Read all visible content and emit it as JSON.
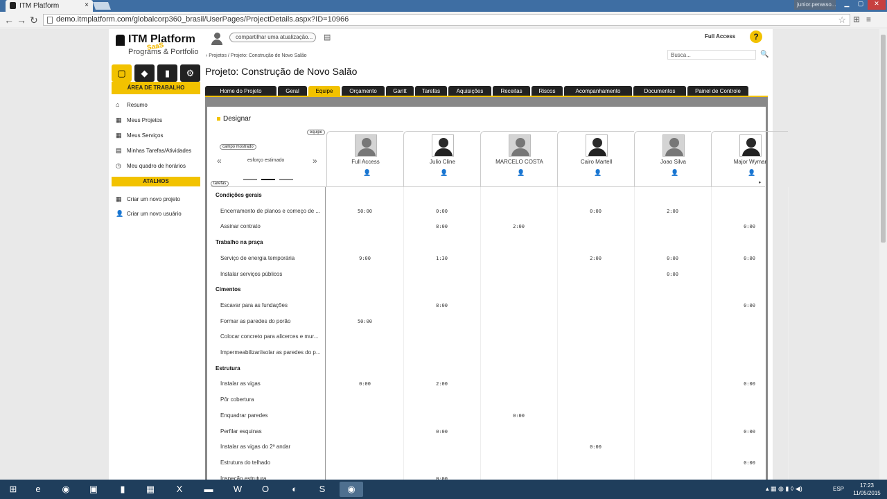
{
  "browser": {
    "tab_title": "ITM Platform",
    "tab_close": "×",
    "user": "junior.perasso...",
    "url": "demo.itmplatform.com/globalcorp360_brasil/UserPages/ProjectDetails.aspx?ID=10966"
  },
  "app": {
    "logo_title": "ITM Platform",
    "logo_subtitle": "Programs & Portfolio",
    "logo_badge": "SaaS",
    "share_placeholder": "compartilhar uma atualização...",
    "full_access": "Full Access",
    "help": "?",
    "breadcrumb": "› Projetos / Projeto: Construção de Novo Salão",
    "search_placeholder": "Busca...",
    "project_title": "Projeto: Construção de Novo Salão"
  },
  "sidebar": {
    "area_title": "ÁREA DE TRABALHO",
    "items": [
      {
        "label": "Resumo",
        "icon": "home-icon"
      },
      {
        "label": "Meus Projetos",
        "icon": "projects-icon"
      },
      {
        "label": "Meus Serviços",
        "icon": "services-icon"
      },
      {
        "label": "Minhas Tarefas/Atividades",
        "icon": "tasks-icon"
      },
      {
        "label": "Meu quadro de horários",
        "icon": "clock-icon"
      }
    ],
    "shortcuts_title": "ATALHOS",
    "shortcuts": [
      {
        "label": "Criar um novo projeto",
        "icon": "new-project-icon"
      },
      {
        "label": "Criar um novo usuário",
        "icon": "new-user-icon"
      }
    ]
  },
  "tabs": [
    "Home do Projeto",
    "Geral",
    "Equipe",
    "Orçamento",
    "Gantt",
    "Tarefas",
    "Aquisições",
    "Receitas",
    "Riscos",
    "Acompanhamento",
    "Documentos",
    "Painel de Controle"
  ],
  "active_tab": "Equipe",
  "designer": {
    "title": "Designar",
    "equipe_label": "equipe",
    "campo_label": "campo mostrado",
    "esforco_label": "esforço estimado",
    "prev": "«",
    "next": "»",
    "tarefas_label": "tarefas",
    "people": [
      "Full Access",
      "Julio Cline",
      "MARCELO COSTA",
      "Cairo Martell",
      "Joao Silva",
      "Major Wymar"
    ],
    "rows": [
      {
        "task": "Condições gerais",
        "group": true,
        "values": [
          "",
          "",
          "",
          "",
          "",
          ""
        ]
      },
      {
        "task": "Encerramento de planos e começo de ...",
        "group": false,
        "values": [
          "50:00",
          "0:00",
          "",
          "0:00",
          "2:00",
          ""
        ]
      },
      {
        "task": "Assinar contrato",
        "group": false,
        "values": [
          "",
          "8:00",
          "2:00",
          "",
          "",
          "0:00"
        ]
      },
      {
        "task": "Trabalho na praça",
        "group": true,
        "values": [
          "",
          "",
          "",
          "",
          "",
          ""
        ]
      },
      {
        "task": "Serviço de energia temporária",
        "group": false,
        "values": [
          "9:00",
          "1:30",
          "",
          "2:00",
          "0:00",
          "0:00"
        ]
      },
      {
        "task": "Instalar serviços públicos",
        "group": false,
        "values": [
          "",
          "",
          "",
          "",
          "0:00",
          ""
        ]
      },
      {
        "task": "Cimentos",
        "group": true,
        "values": [
          "",
          "",
          "",
          "",
          "",
          ""
        ]
      },
      {
        "task": "Escavar para as fundações",
        "group": false,
        "values": [
          "",
          "8:00",
          "",
          "",
          "",
          "0:00"
        ]
      },
      {
        "task": "Formar as paredes do porão",
        "group": false,
        "values": [
          "50:00",
          "",
          "",
          "",
          "",
          ""
        ]
      },
      {
        "task": "Colocar concreto para alicerces e mur...",
        "group": false,
        "values": [
          "",
          "",
          "",
          "",
          "",
          ""
        ]
      },
      {
        "task": "Impermeabilizar/isolar as paredes do p...",
        "group": false,
        "values": [
          "",
          "",
          "",
          "",
          "",
          ""
        ]
      },
      {
        "task": "Estrutura",
        "group": true,
        "values": [
          "",
          "",
          "",
          "",
          "",
          ""
        ]
      },
      {
        "task": "Instalar as vigas",
        "group": false,
        "values": [
          "0:00",
          "2:00",
          "",
          "",
          "",
          "0:00"
        ]
      },
      {
        "task": "Pôr cobertura",
        "group": false,
        "values": [
          "",
          "",
          "",
          "",
          "",
          ""
        ]
      },
      {
        "task": "Enquadrar paredes",
        "group": false,
        "values": [
          "",
          "",
          "0:00",
          "",
          "",
          ""
        ]
      },
      {
        "task": "Perfilar esquinas",
        "group": false,
        "values": [
          "",
          "0:00",
          "",
          "",
          "",
          "0:00"
        ]
      },
      {
        "task": "Instalar as vigas do 2º andar",
        "group": false,
        "values": [
          "",
          "",
          "",
          "0:00",
          "",
          ""
        ]
      },
      {
        "task": "Estrutura do telhado",
        "group": false,
        "values": [
          "",
          "",
          "",
          "",
          "",
          "0:00"
        ]
      },
      {
        "task": "Inspeção estrutura",
        "group": false,
        "values": [
          "",
          "0:00",
          "",
          "",
          "",
          ""
        ]
      }
    ]
  },
  "taskbar": {
    "lang": "ESP",
    "time": "17:23",
    "date": "11/05/2015"
  }
}
